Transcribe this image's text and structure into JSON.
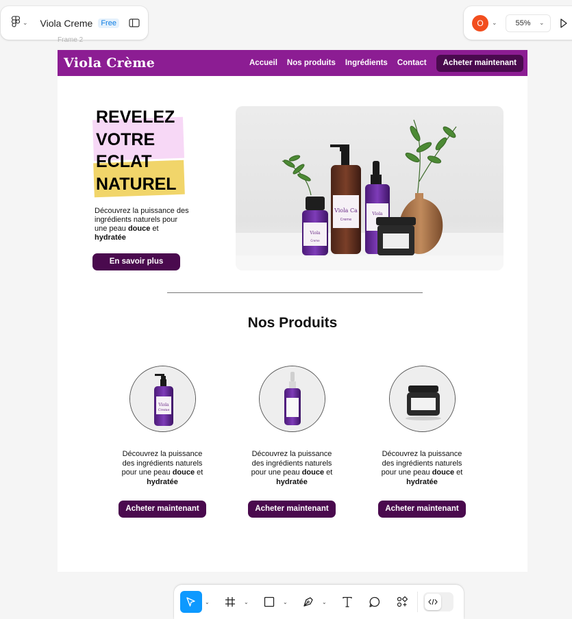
{
  "app": {
    "file_title": "Viola Creme",
    "plan_badge": "Free",
    "avatar_initial": "O",
    "zoom": "55%",
    "frame_label": "Frame 2",
    "accent_color": "#0d99ff"
  },
  "site": {
    "logo": "Viola Crème",
    "brand_color": "#8c1d93",
    "button_color": "#4a0a4e",
    "nav": [
      "Accueil",
      "Nos produits",
      "Ingrédients",
      "Contact"
    ],
    "nav_cta": "Acheter maintenant",
    "hero": {
      "title_lines": [
        "REVELEZ",
        "VOTRE",
        "ECLAT",
        "NATUREL"
      ],
      "text_start": "Découvrez la puissance des ingrédients naturels pour une peau ",
      "bold1": "douce",
      "text_mid": " et ",
      "bold2": "hydratée",
      "button": "En savoir plus",
      "image": {
        "label_large": "Viola Ca",
        "label_large_sub": "Creme",
        "label_small": "Viola",
        "label_small_sub": "Creme",
        "label_dropper": "Viola"
      }
    },
    "products_title": "Nos Produits",
    "products": [
      {
        "text_start": "Découvrez la puissance des ingrédients naturels pour une peau ",
        "bold1": "douce",
        "text_mid": " et ",
        "bold2": "hydratée",
        "button": "Acheter maintenant",
        "label": "Viola",
        "label_sub": "Creme"
      },
      {
        "text_start": "Découvrez la puissance des ingrédients naturels pour une peau ",
        "bold1": "douce",
        "text_mid": " et ",
        "bold2": "hydratée",
        "button": "Acheter maintenant"
      },
      {
        "text_start": "Découvrez la puissance des ingrédients naturels pour une peau ",
        "bold1": "douce",
        "text_mid": " et ",
        "bold2": "hydratée",
        "button": "Acheter maintenant"
      }
    ]
  },
  "toolbar": {
    "tools": [
      "move-icon",
      "frame-icon",
      "rectangle-icon",
      "pen-icon",
      "text-icon",
      "comment-icon",
      "actions-icon",
      "dev-mode-icon"
    ]
  }
}
